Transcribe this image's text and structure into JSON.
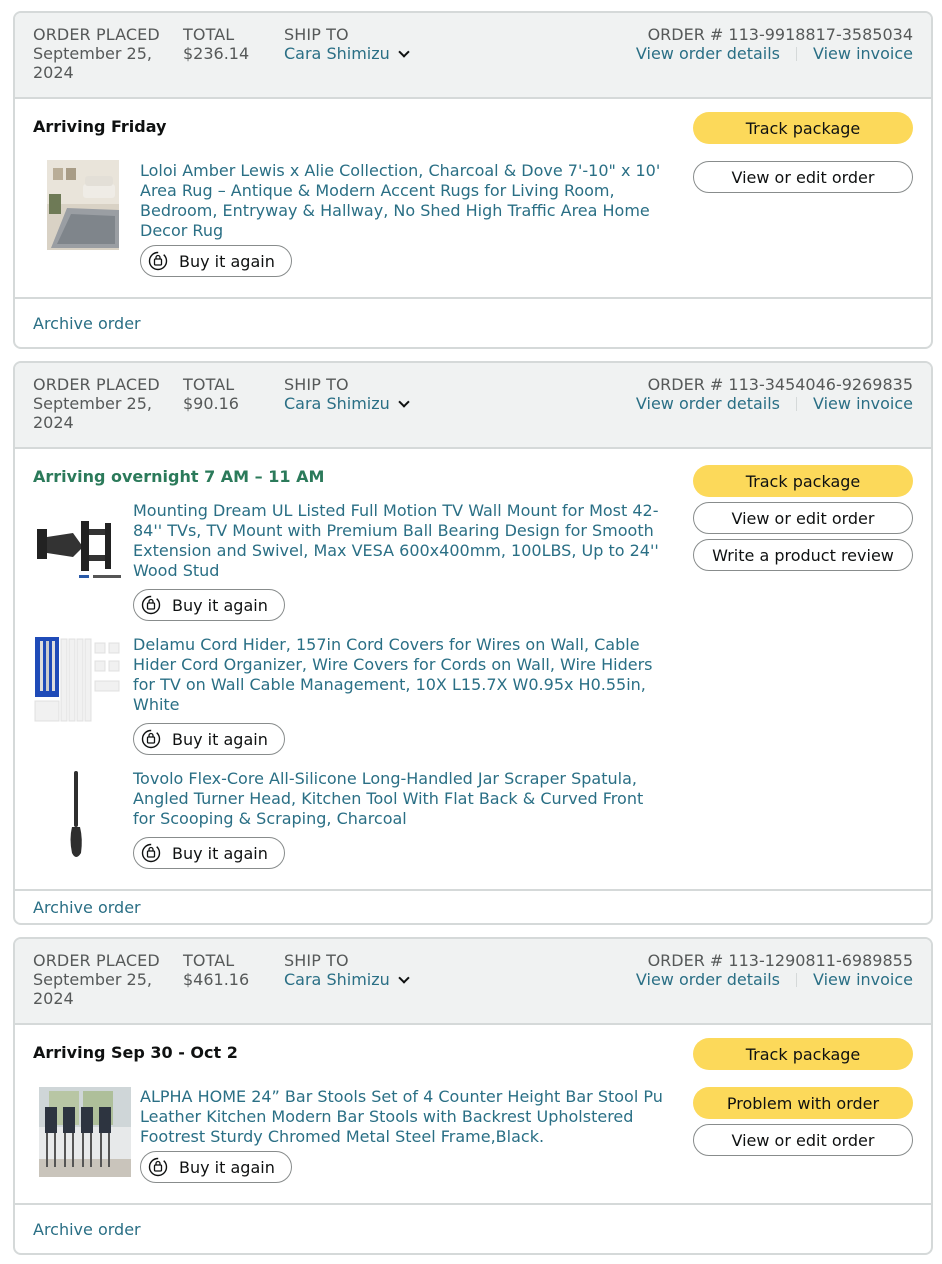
{
  "labels": {
    "order_placed": "ORDER PLACED",
    "total": "TOTAL",
    "ship_to": "SHIP TO",
    "view_order_details": "View order details",
    "view_invoice": "View invoice",
    "buy_again": "Buy it again",
    "archive": "Archive order"
  },
  "orders": [
    {
      "date_line1": "September 25,",
      "date_line2": "2024",
      "total": "$236.14",
      "ship_to": "Cara Shimizu",
      "order_number": "ORDER # 113-9918817-3585034",
      "status": "Arriving Friday",
      "actions": [
        "Track package",
        "View or edit order"
      ],
      "items": [
        {
          "title": "Loloi Amber Lewis x Alie Collection, Charcoal & Dove 7'-10\" x 10' Area Rug – Antique & Modern Accent Rugs for Living Room, Bedroom, Entryway & Hallway, No Shed High Traffic Area Home Decor Rug"
        }
      ]
    },
    {
      "date_line1": "September 25,",
      "date_line2": "2024",
      "total": "$90.16",
      "ship_to": "Cara Shimizu",
      "order_number": "ORDER # 113-3454046-9269835",
      "status": "Arriving overnight 7 AM – 11 AM",
      "actions": [
        "Track package",
        "View or edit order",
        "Write a product review"
      ],
      "items": [
        {
          "title": "Mounting Dream UL Listed Full Motion TV Wall Mount for Most 42-84'' TVs, TV Mount with Premium Ball Bearing Design for Smooth Extension and Swivel, Max VESA 600x400mm, 100LBS, Up to 24'' Wood Stud"
        },
        {
          "title": "Delamu Cord Hider, 157in Cord Covers for Wires on Wall, Cable Hider Cord Organizer, Wire Covers for Cords on Wall, Wire Hiders for TV on Wall Cable Management, 10X L15.7X W0.95x H0.55in, White"
        },
        {
          "title": "Tovolo Flex-Core All-Silicone Long-Handled Jar Scraper Spatula, Angled Turner Head, Kitchen Tool With Flat Back & Curved Front for Scooping & Scraping, Charcoal"
        }
      ]
    },
    {
      "date_line1": "September 25,",
      "date_line2": "2024",
      "total": "$461.16",
      "ship_to": "Cara Shimizu",
      "order_number": "ORDER # 113-1290811-6989855",
      "status": "Arriving Sep 30 - Oct 2",
      "actions": [
        "Track package",
        "Problem with order",
        "View or edit order"
      ],
      "items": [
        {
          "title": "ALPHA HOME 24” Bar Stools Set of 4 Counter Height Bar Stool Pu Leather Kitchen Modern Bar Stools with Backrest Upholstered Footrest Sturdy Chromed Metal Steel Frame,Black."
        }
      ]
    }
  ]
}
